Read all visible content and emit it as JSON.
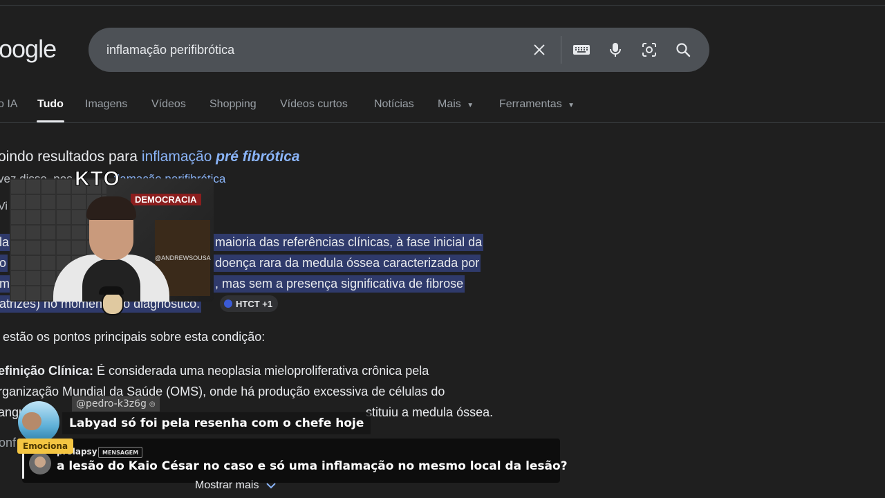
{
  "search": {
    "logo": "oogle",
    "query": "inflamação perifibrótica"
  },
  "tabs": [
    "o IA",
    "Tudo",
    "Imagens",
    "Vídeos",
    "Shopping",
    "Vídeos curtos",
    "Notícias",
    "Mais",
    "Ferramentas"
  ],
  "active_tab": "Tudo",
  "spell": {
    "prefix": "oindo resultados para ",
    "link_plain": "inflamação ",
    "link_bold": "pré fibrótica",
    "alt_prefix": "vez disse, pos",
    "alt_link": "flamação perifibrótica"
  },
  "ai_overview": {
    "vi_fragment": "Vi",
    "hl_lines": [
      {
        "lead": "la",
        "text": "maioria das referências clínicas, à fase inicial da"
      },
      {
        "lead": "o",
        "text": "doença rara da medula óssea caracterizada por"
      },
      {
        "lead": "m",
        "text": ", mas sem a presença significativa de fibrose"
      },
      {
        "lead": "atrizes) no momento do diagnóstico.",
        "text": ""
      }
    ],
    "source_chip": "HTCT +1",
    "intro": "estão os pontos principais sobre esta condição:",
    "def_label": "efinição Clínica:",
    "def_text": " É considerada uma neoplasia mieloproliferativa crônica pela",
    "def_line2": "rganização Mundial da Saúde (OMS), onde há produção excessiva de células do",
    "def_line3_a": "angu",
    "def_line3_b": "stituiu a medula óssea.",
    "frag": "onf",
    "show_more": "Mostrar mais"
  },
  "stream": {
    "kto": "KTO",
    "cam_banner": "DEMOCRACIA",
    "cam_handle": "@ANDREWSOUSA",
    "chat1_user": "@pedro-k3z6g",
    "chat1_msg": "Labyad só foi pela resenha com o chefe hoje",
    "badge": "Emociona",
    "chat2_user": "prolapsy",
    "chat2_tag": "MENSAGEM",
    "chat2_msg": "a lesão do Kaio César no caso e só uma inflamação no mesmo local da lesão?"
  }
}
